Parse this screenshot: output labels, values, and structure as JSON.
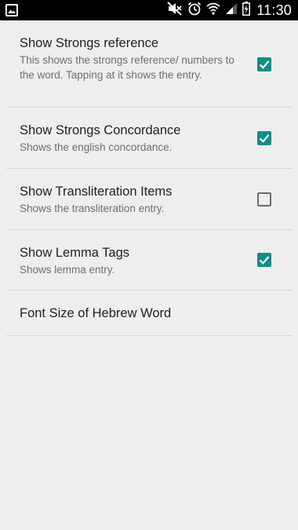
{
  "status_bar": {
    "time": "11:30",
    "left_icon": "gallery-notification-icon",
    "icons": [
      "mute-icon",
      "alarm-icon",
      "wifi-icon",
      "signal-icon",
      "battery-charging-icon"
    ]
  },
  "colors": {
    "background": "#eeeeee",
    "accent": "#0f8f86",
    "title": "#212121",
    "summary": "#6f6f6f",
    "divider": "#d6d6d6"
  },
  "preferences": [
    {
      "title": "Show Strongs reference",
      "summary": "This shows the strongs reference/ numbers to the word. Tapping at it shows the entry.",
      "checked": true
    },
    {
      "title": "Show Strongs Concordance",
      "summary": "Shows the english concordance.",
      "checked": true
    },
    {
      "title": "Show Transliteration Items",
      "summary": "Shows the transliteration entry.",
      "checked": false
    },
    {
      "title": "Show Lemma Tags",
      "summary": "Shows lemma entry.",
      "checked": true
    },
    {
      "title": "Font Size of Hebrew Word"
    }
  ]
}
